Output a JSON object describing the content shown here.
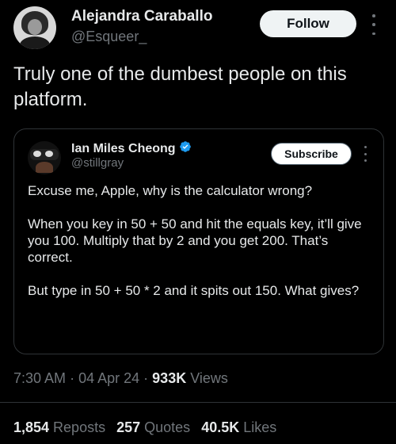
{
  "tweet": {
    "author": {
      "name": "Alejandra Caraballo",
      "handle": "@Esqueer_"
    },
    "follow_label": "Follow",
    "text": "Truly one of the dumbest people on this platform.",
    "time": "7:30 AM",
    "separator": "·",
    "date": "04 Apr 24",
    "views_count": "933K",
    "views_label": "Views",
    "stats": {
      "reposts_count": "1,854",
      "reposts_label": "Reposts",
      "quotes_count": "257",
      "quotes_label": "Quotes",
      "likes_count": "40.5K",
      "likes_label": "Likes"
    }
  },
  "quote": {
    "author": {
      "name": "Ian Miles Cheong",
      "handle": "@stillgray",
      "verified": true
    },
    "subscribe_label": "Subscribe",
    "paragraphs": [
      "Excuse me, Apple, why is the calculator wrong?",
      "When you key in 50 + 50 and hit the equals key, it’ll give you 100. Multiply that by 2 and you get 200. That’s correct.",
      "But type in 50 + 50 * 2 and it spits out 150. What gives?"
    ]
  },
  "colors": {
    "background": "#000000",
    "text_primary": "#e7e9ea",
    "text_secondary": "#71767b",
    "verified_badge": "#1d9bf0",
    "border": "#2f3336"
  },
  "icons": [
    "more-options-icon",
    "verified-badge-icon"
  ]
}
